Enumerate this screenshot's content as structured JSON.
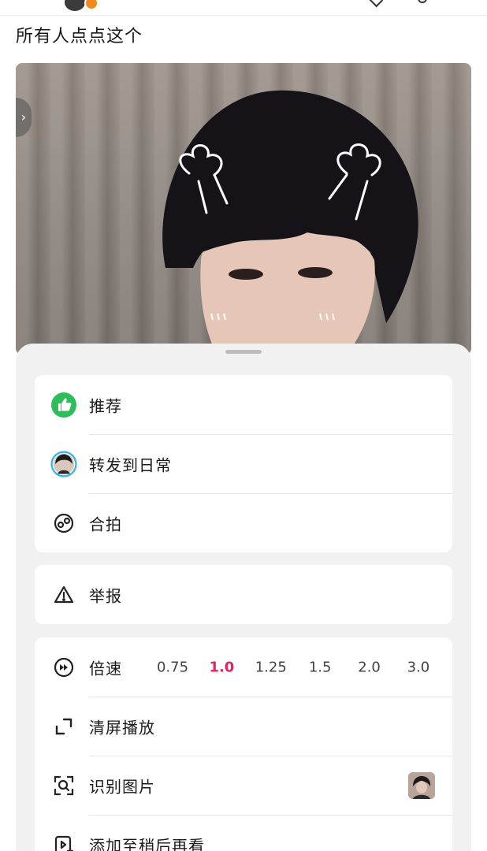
{
  "post": {
    "title": "所有人点点这个"
  },
  "sheet": {
    "group1": [
      {
        "label": "推荐",
        "icon": "thumbs-up-icon",
        "icon_color": "#2dbd5a"
      },
      {
        "label": "转发到日常",
        "icon": "user-avatar-icon"
      },
      {
        "label": "合拍",
        "icon": "duet-icon"
      }
    ],
    "group2": [
      {
        "label": "举报",
        "icon": "warning-icon"
      }
    ],
    "group3": {
      "speed": {
        "label": "倍速",
        "icon": "speed-icon",
        "options": [
          "0.75",
          "1.0",
          "1.25",
          "1.5",
          "2.0",
          "3.0"
        ],
        "selected": "1.0",
        "accent": "#e0245e"
      },
      "items": [
        {
          "label": "清屏播放",
          "icon": "fullscreen-icon"
        },
        {
          "label": "识别图片",
          "icon": "scan-image-icon"
        },
        {
          "label": "添加至稍后再看",
          "icon": "watch-later-icon"
        }
      ]
    }
  },
  "colors": {
    "highlight": "#aee646",
    "sheet_bg": "#f1f1f1"
  }
}
